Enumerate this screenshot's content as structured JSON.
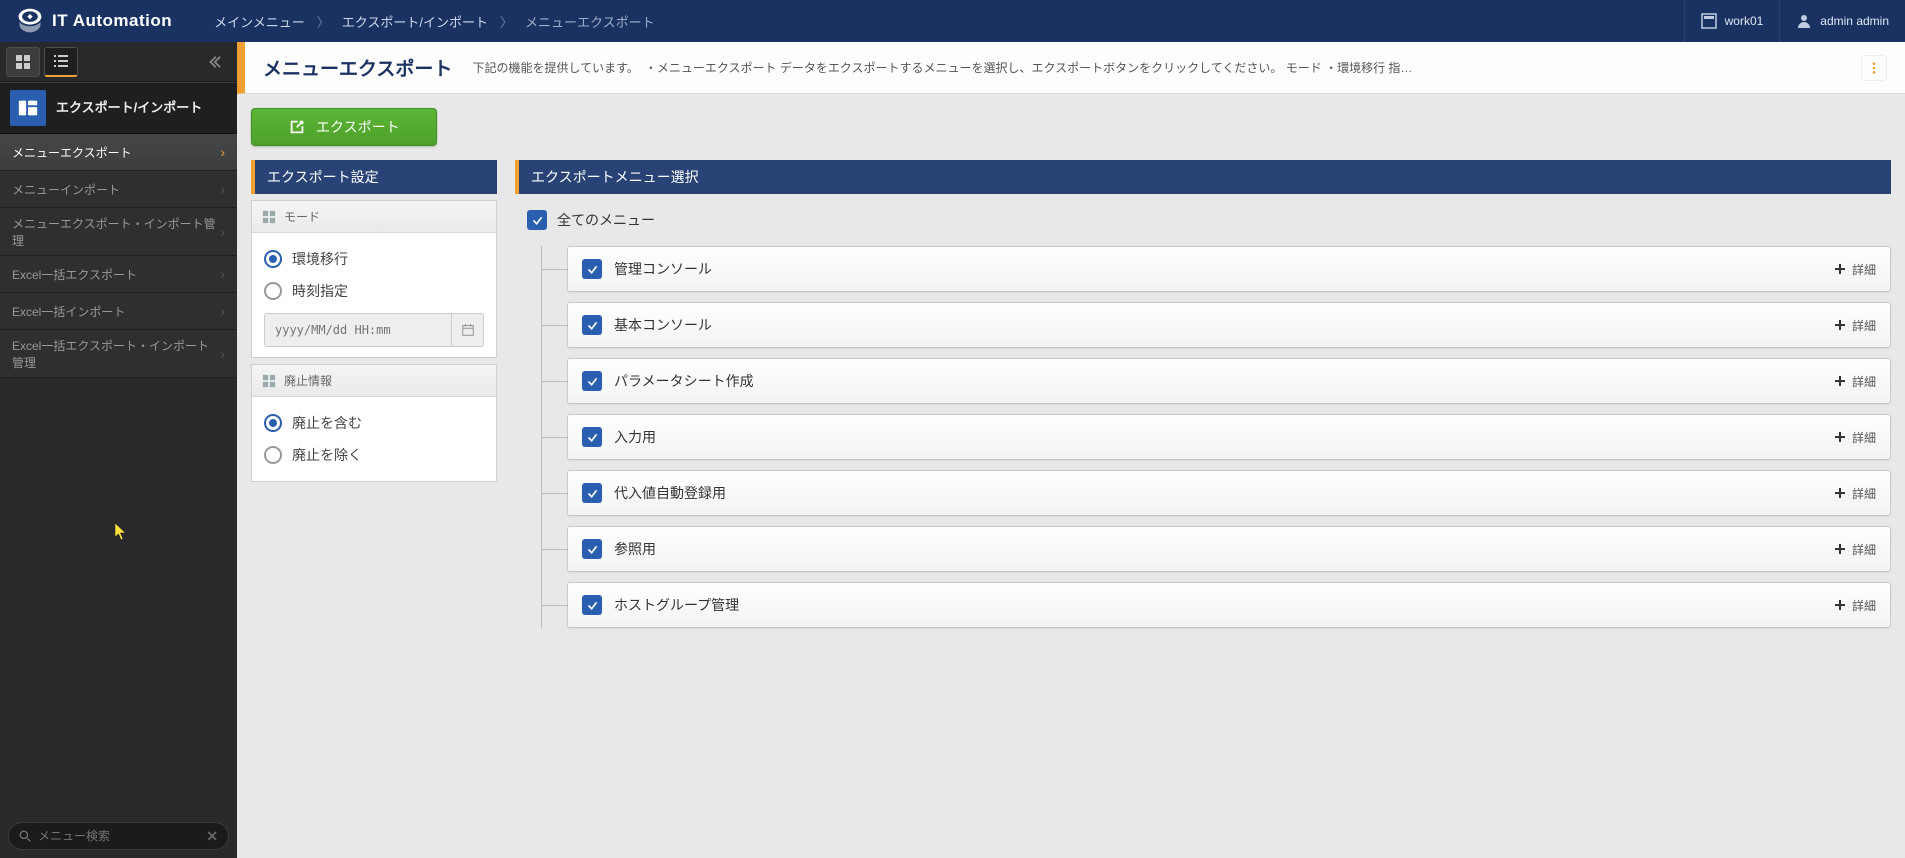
{
  "app_name": "IT Automation",
  "breadcrumbs": [
    "メインメニュー",
    "エクスポート/インポート",
    "メニューエクスポート"
  ],
  "workspace_label": "work01",
  "user_label": "admin admin",
  "sidebar": {
    "group_title": "エクスポート/インポート",
    "items": [
      {
        "label": "メニューエクスポート",
        "active": true
      },
      {
        "label": "メニューインポート"
      },
      {
        "label": "メニューエクスポート・インポート管理"
      },
      {
        "label": "Excel一括エクスポート"
      },
      {
        "label": "Excel一括インポート"
      },
      {
        "label": "Excel一括エクスポート・インポート管理"
      }
    ],
    "search_placeholder": "メニュー検索"
  },
  "page": {
    "title": "メニューエクスポート",
    "description": "下記の機能を提供しています。　・メニューエクスポート データをエクスポートするメニューを選択し、エクスポートボタンをクリックしてください。 モード ・環境移行 指…",
    "export_button": "エクスポート"
  },
  "settings": {
    "panel_title": "エクスポート設定",
    "mode": {
      "header": "モード",
      "options": [
        "環境移行",
        "時刻指定"
      ],
      "selected": "環境移行",
      "date_placeholder": "yyyy/MM/dd HH:mm"
    },
    "discard": {
      "header": "廃止情報",
      "options": [
        "廃止を含む",
        "廃止を除く"
      ],
      "selected": "廃止を含む"
    }
  },
  "menu_select": {
    "panel_title": "エクスポートメニュー選択",
    "all_label": "全てのメニュー",
    "detail_label": "詳細",
    "items": [
      "管理コンソール",
      "基本コンソール",
      "パラメータシート作成",
      "入力用",
      "代入値自動登録用",
      "参照用",
      "ホストグループ管理"
    ]
  }
}
